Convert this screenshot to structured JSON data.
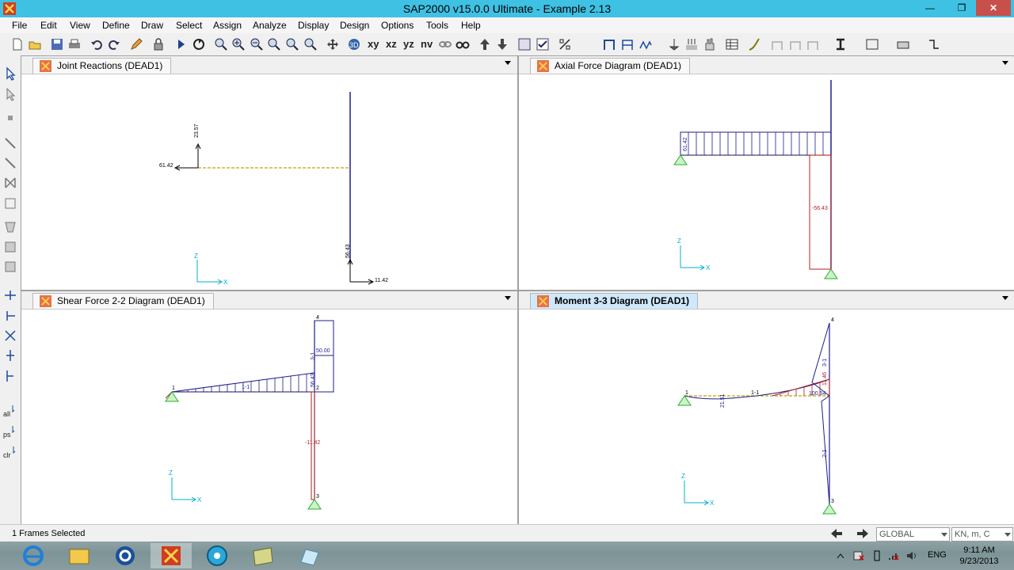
{
  "window": {
    "title": "SAP2000 v15.0.0 Ultimate  - Example 2.13",
    "min": "0",
    "max": "1",
    "close": "r"
  },
  "menu": [
    "File",
    "Edit",
    "View",
    "Define",
    "Draw",
    "Select",
    "Assign",
    "Analyze",
    "Display",
    "Design",
    "Options",
    "Tools",
    "Help"
  ],
  "toolbar": {
    "view_xy": "xy",
    "view_xz": "xz",
    "view_yz": "yz",
    "view_nv": "nv"
  },
  "panes": {
    "joint_reactions": {
      "tab": "Joint Reactions   (DEAD1)",
      "labels": {
        "r1_vert": "23.57",
        "r1_horz": "61.42",
        "r2_vert": "56.43",
        "r2_horz": "11.42",
        "axis_z": "Z",
        "axis_x": "X"
      }
    },
    "axial_force": {
      "tab": "Axial Force Diagram   (DEAD1)",
      "labels": {
        "beam_val": "61.42",
        "col_val": "-56.43",
        "axis_z": "Z",
        "axis_x": "X"
      }
    },
    "shear_force": {
      "tab": "Shear Force 2-2 Diagram   (DEAD1)",
      "labels": {
        "node4": "4",
        "node1": "1",
        "node2": "2",
        "node3": "3",
        "top_val": "50.00",
        "col_label": "3-1",
        "mid_val": "56.43",
        "beam_label": "1-1",
        "lower_val": "-11.42",
        "axis_z": "Z",
        "axis_x": "X"
      }
    },
    "moment": {
      "tab": "Moment 3-3 Diagram   (DEAD1)",
      "labels": {
        "node4": "4",
        "node1": "1",
        "node3": "3",
        "beam_label": "1-1",
        "col_label": "3-1",
        "beam_val": "21.51",
        "corner_val": "100.54",
        "col_val": "2-1",
        "red_val": "11.46",
        "axis_z": "Z",
        "axis_x": "X"
      }
    }
  },
  "statusbar": {
    "text": "1 Frames Selected",
    "coord_system": "GLOBAL",
    "units": "KN, m, C"
  },
  "taskbar": {
    "lang": "ENG",
    "time": "9:11 AM",
    "date": "9/23/2013"
  },
  "colors": {
    "titlebar": "#3fc1e4",
    "diagram_blue": "#1f1f8f",
    "diagram_red": "#b22222",
    "support_green": "#33cc33",
    "axis_cyan": "#00b0d0"
  }
}
